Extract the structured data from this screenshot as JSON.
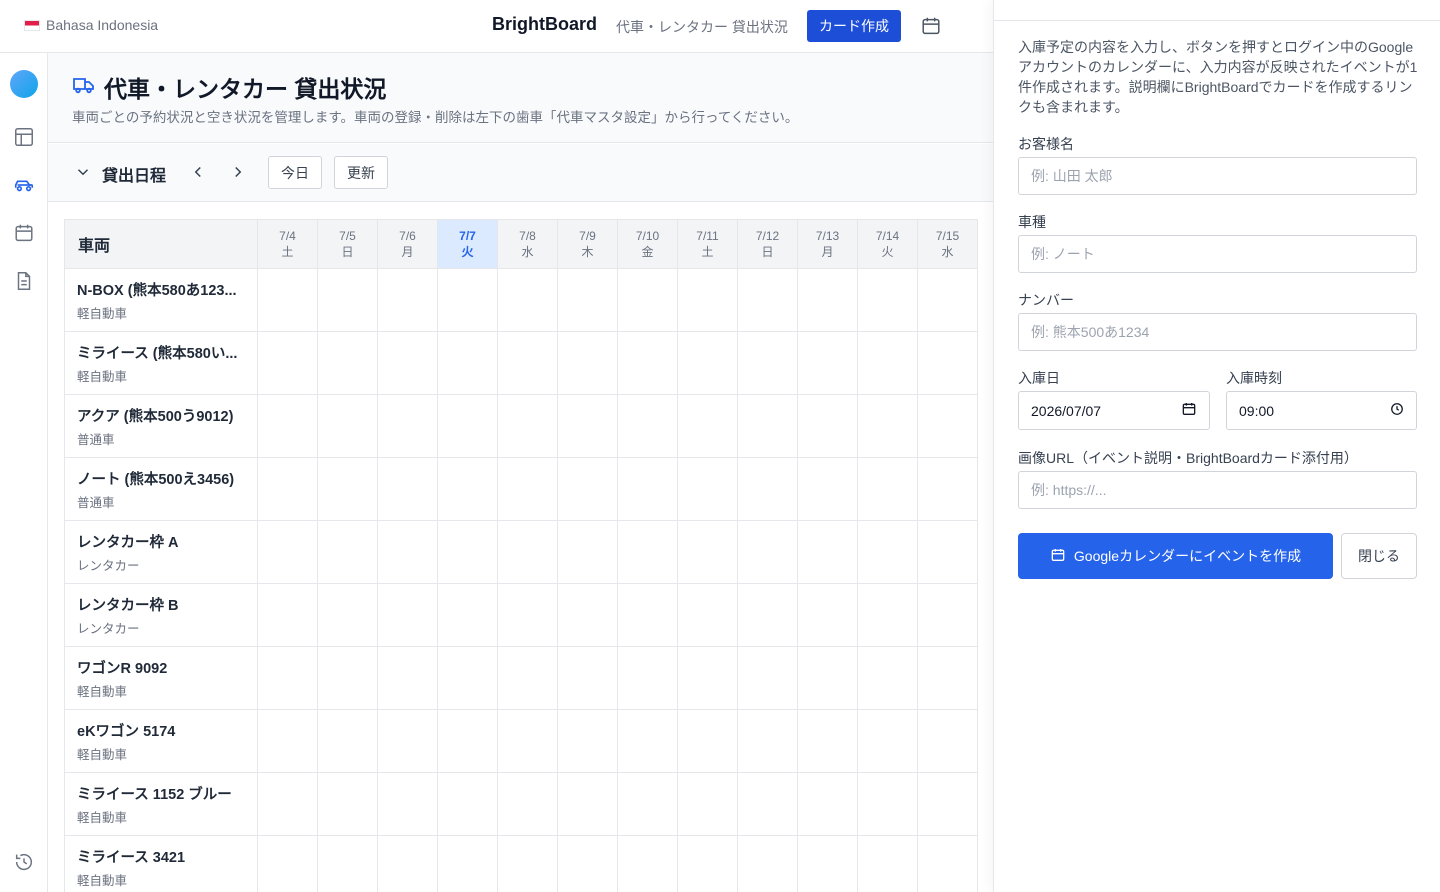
{
  "header": {
    "language": "Bahasa Indonesia",
    "brand": "BrightBoard",
    "subtitle": "代車・レンタカー 貸出状況",
    "create_card_label": "カード作成"
  },
  "page": {
    "title": "代車・レンタカー 貸出状況",
    "description": "車両ごとの予約状況と空き状況を管理します。車両の登録・削除は左下の歯車「代車マスタ設定」から行ってください。"
  },
  "toolbar": {
    "title": "貸出日程",
    "today_label": "今日",
    "refresh_label": "更新"
  },
  "grid": {
    "vehicle_header": "車両",
    "days": [
      {
        "date": "7/4",
        "weekday": "土"
      },
      {
        "date": "7/5",
        "weekday": "日"
      },
      {
        "date": "7/6",
        "weekday": "月"
      },
      {
        "date": "7/7",
        "weekday": "火",
        "today": true
      },
      {
        "date": "7/8",
        "weekday": "水"
      },
      {
        "date": "7/9",
        "weekday": "木"
      },
      {
        "date": "7/10",
        "weekday": "金"
      },
      {
        "date": "7/11",
        "weekday": "土"
      },
      {
        "date": "7/12",
        "weekday": "日"
      },
      {
        "date": "7/13",
        "weekday": "月"
      },
      {
        "date": "7/14",
        "weekday": "火"
      },
      {
        "date": "7/15",
        "weekday": "水"
      }
    ],
    "vehicles": [
      {
        "name": "N-BOX (熊本580あ123...",
        "type": "軽自動車"
      },
      {
        "name": "ミライース (熊本580い...",
        "type": "軽自動車"
      },
      {
        "name": "アクア (熊本500う9012)",
        "type": "普通車"
      },
      {
        "name": "ノート (熊本500え3456)",
        "type": "普通車"
      },
      {
        "name": "レンタカー枠 A",
        "type": "レンタカー"
      },
      {
        "name": "レンタカー枠 B",
        "type": "レンタカー"
      },
      {
        "name": "ワゴンR 9092",
        "type": "軽自動車"
      },
      {
        "name": "eKワゴン 5174",
        "type": "軽自動車"
      },
      {
        "name": "ミライース 1152 ブルー",
        "type": "軽自動車"
      },
      {
        "name": "ミライース 3421",
        "type": "軽自動車"
      }
    ]
  },
  "panel": {
    "description": "入庫予定の内容を入力し、ボタンを押すとログイン中のGoogleアカウントのカレンダーに、入力内容が反映されたイベントが1件作成されます。説明欄にBrightBoardでカードを作成するリンクも含まれます。",
    "customer_label": "お客様名",
    "customer_placeholder": "例: 山田 太郎",
    "model_label": "車種",
    "model_placeholder": "例: ノート",
    "number_label": "ナンバー",
    "number_placeholder": "例: 熊本500あ1234",
    "date_label": "入庫日",
    "date_value": "2026/07/07",
    "time_label": "入庫時刻",
    "time_value": "09:00",
    "image_label": "画像URL（イベント説明・BrightBoardカード添付用）",
    "image_placeholder": "例: https://...",
    "submit_label": "Googleカレンダーにイベントを作成",
    "close_label": "閉じる"
  },
  "colors": {
    "primary": "#2563eb",
    "brand_button": "#1d4ed8",
    "today_bg": "#dbeafe"
  }
}
